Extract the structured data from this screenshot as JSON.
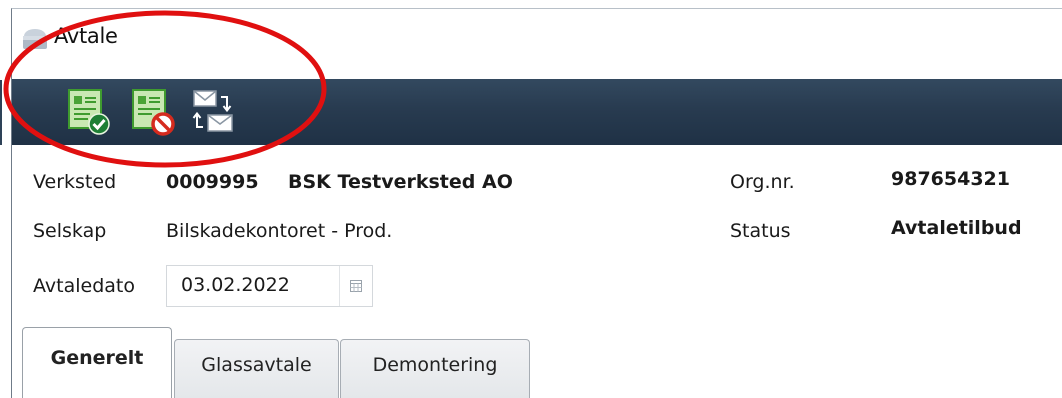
{
  "window": {
    "title": "Avtale"
  },
  "toolbar": {
    "buttons": [
      {
        "icon": "accept-document-icon"
      },
      {
        "icon": "reject-document-icon"
      },
      {
        "icon": "send-receive-mail-icon"
      }
    ]
  },
  "fields": {
    "verksted": {
      "label": "Verksted",
      "number": "0009995",
      "name": "BSK Testverksted AO"
    },
    "selskap": {
      "label": "Selskap",
      "value": "Bilskadekontoret - Prod."
    },
    "avtaledato": {
      "label": "Avtaledato",
      "value": "03.02.2022"
    },
    "orgnr": {
      "label": "Org.nr.",
      "value": "987654321"
    },
    "status": {
      "label": "Status",
      "value": "Avtaletilbud"
    }
  },
  "tabs": [
    {
      "label": "Generelt",
      "active": true
    },
    {
      "label": "Glassavtale",
      "active": false
    },
    {
      "label": "Demontering",
      "active": false
    }
  ],
  "colors": {
    "toolbar": "#283b50",
    "highlight": "#e01010",
    "doc_green": "#3f9b2f"
  }
}
